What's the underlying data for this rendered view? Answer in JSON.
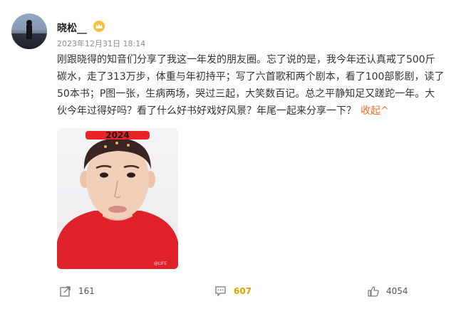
{
  "post": {
    "author": "晓松__",
    "timestamp": "2023年12月31日  18:14",
    "lines": [
      "刚跟晓得的知音们分享了我这一年发的朋友圈。忘了说的是，我今年还认真戒了500斤",
      "碳水，走了313万步，体重与年初持平；写了六首歌和两个剧本，看了100部影剧，读了",
      "50本书；P图一张，生病两场，哭过三起，大笑数百记。总之平静知足又蹉跎一年。大",
      "伙今年过得好吗？看了什么好书好戏好风景？年尾一起来分享一下？"
    ],
    "collapse_label": "收起^",
    "image": {
      "sign_text": "2024",
      "watermark": "@LIFE"
    }
  },
  "actions": {
    "share": "161",
    "comments": "607",
    "likes": "4054"
  },
  "colors": {
    "accent": "#f26d22",
    "comment": "#d9a400"
  },
  "icons": [
    "share-icon",
    "comment-icon",
    "like-icon",
    "crown-icon"
  ]
}
